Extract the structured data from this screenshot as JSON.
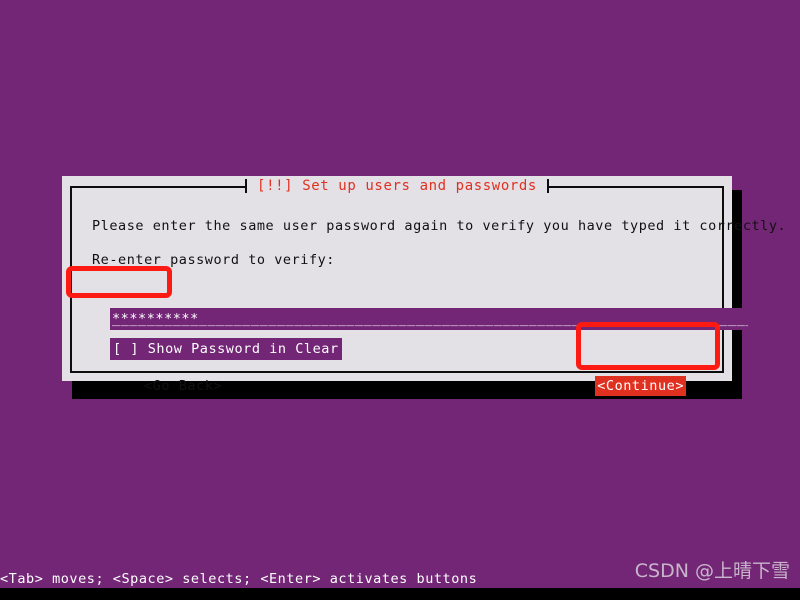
{
  "screen": {
    "background_color": "#722675",
    "accent_red": "#e03020",
    "highlight_red": "#fc1a13",
    "dialog_bg": "#e4e1e6",
    "field_purple": "#722675"
  },
  "dialog": {
    "title": "[!!] Set up users and passwords",
    "prompt": "Please enter the same user password again to verify you have typed it correctly.",
    "field_label": "Re-enter password to verify:",
    "password": {
      "masked_value": "**********",
      "fill": "___________________________________________________________________________________________",
      "placeholder": ""
    },
    "checkbox": {
      "label": "[ ] Show Password in Clear",
      "checked": false
    },
    "buttons": {
      "go_back": "<Go Back>",
      "continue": "<Continue>"
    }
  },
  "annotations": {
    "password_box": "highlight-password-field",
    "continue_box": "highlight-continue-button"
  },
  "statusbar": {
    "help": "<Tab> moves; <Space> selects; <Enter> activates buttons"
  },
  "watermark": {
    "text": "CSDN @上晴下雪"
  }
}
